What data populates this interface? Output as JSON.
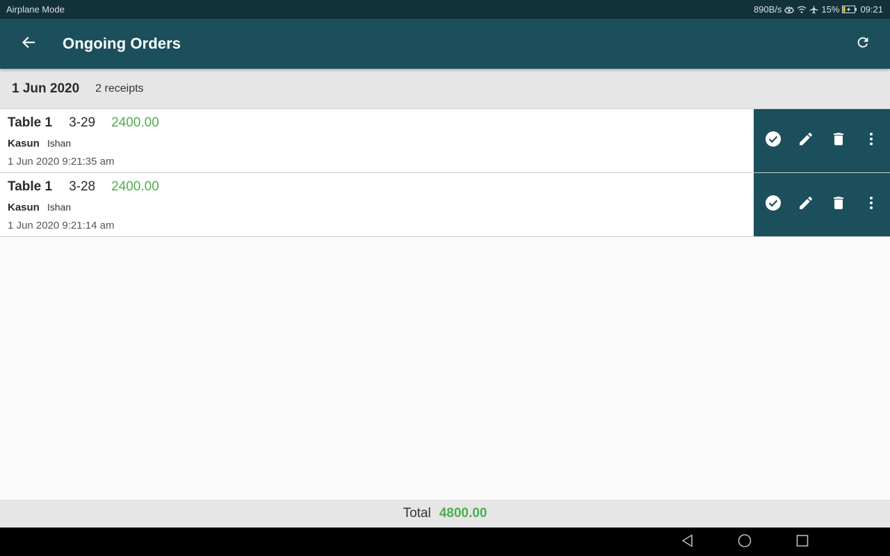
{
  "status_bar": {
    "left_text": "Airplane Mode",
    "net_speed": "890B/s",
    "icons": [
      "eye-comfort-icon",
      "wifi-icon",
      "airplane-icon",
      "battery-charging-icon"
    ],
    "battery": "15%",
    "time": "09:21"
  },
  "app_bar": {
    "title": "Ongoing Orders",
    "back_icon": "arrow-back-icon",
    "refresh_icon": "refresh-icon"
  },
  "date_header": {
    "date": "1 Jun 2020",
    "count": "2 receipts"
  },
  "orders": [
    {
      "table": "Table 1",
      "receipt_no": "3-29",
      "amount": "2400.00",
      "waiter": "Kasun",
      "cashier": "Ishan",
      "datetime": "1 Jun 2020 9:21:35 am"
    },
    {
      "table": "Table 1",
      "receipt_no": "3-28",
      "amount": "2400.00",
      "waiter": "Kasun",
      "cashier": "Ishan",
      "datetime": "1 Jun 2020 9:21:14 am"
    }
  ],
  "row_actions": [
    "check-circle-icon",
    "edit-pencil-icon",
    "delete-trash-icon",
    "more-vert-icon"
  ],
  "footer": {
    "label": "Total",
    "value": "4800.00"
  },
  "nav_bar": [
    "back-triangle-icon",
    "home-circle-icon",
    "recents-square-icon"
  ],
  "colors": {
    "primary": "#1c4f5c",
    "status_bar": "#13313b",
    "amount_green": "#4caf50",
    "header_bg": "#e6e6e6"
  }
}
